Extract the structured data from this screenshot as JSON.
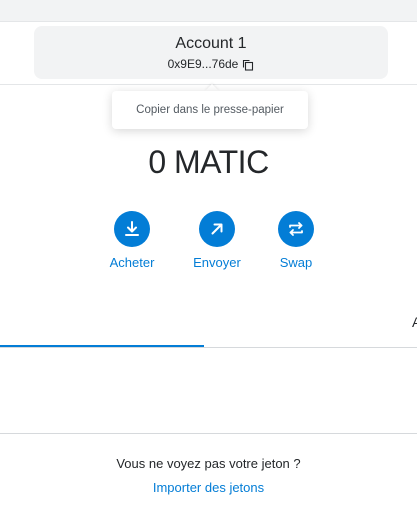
{
  "account": {
    "name": "Account 1",
    "address_short": "0x9E9...76de",
    "copy_icon": "copy-icon"
  },
  "tooltip": {
    "text": "Copier dans le presse-papier"
  },
  "balance": {
    "text": "0 MATIC"
  },
  "actions": [
    {
      "label": "Acheter",
      "icon": "download-icon"
    },
    {
      "label": "Envoyer",
      "icon": "arrow-up-right-icon"
    },
    {
      "label": "Swap",
      "icon": "swap-icon"
    }
  ],
  "tabs": {
    "partial_label": "A"
  },
  "import": {
    "question": "Vous ne voyez pas votre jeton ?",
    "link_label": "Importer des jetons"
  },
  "colors": {
    "accent": "#037dd6",
    "text": "#24272a",
    "card_bg": "#f2f3f4"
  }
}
